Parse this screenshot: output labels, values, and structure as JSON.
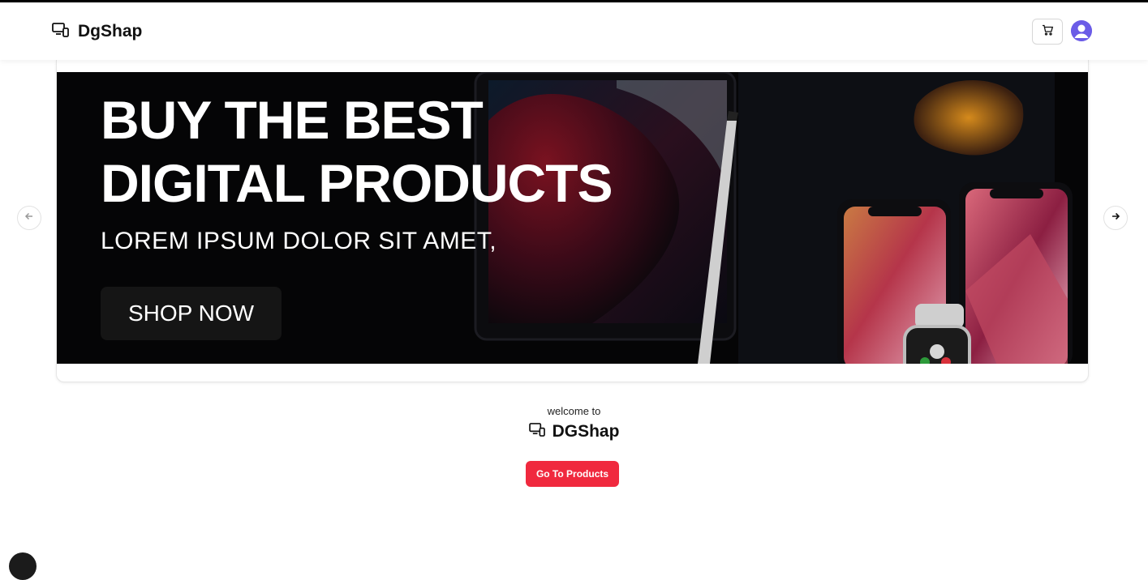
{
  "header": {
    "brand": "DgShap",
    "icons": {
      "logo": "devices-icon",
      "cart": "cart-icon",
      "avatar": "user-avatar-icon"
    }
  },
  "hero": {
    "title_line1": "BUY THE BEST",
    "title_line2": "DIGITAL PRODUCTS",
    "subtitle": "LOREM IPSUM DOLOR SIT AMET,",
    "cta": "SHOP NOW",
    "prev_icon": "arrow-left-icon",
    "next_icon": "arrow-right-icon"
  },
  "welcome": {
    "label": "welcome to",
    "brand": "DGShap",
    "button": "Go To Products"
  },
  "colors": {
    "accent": "#f0293e",
    "avatar": "#6b5ce7",
    "hero_bg": "#050506"
  }
}
